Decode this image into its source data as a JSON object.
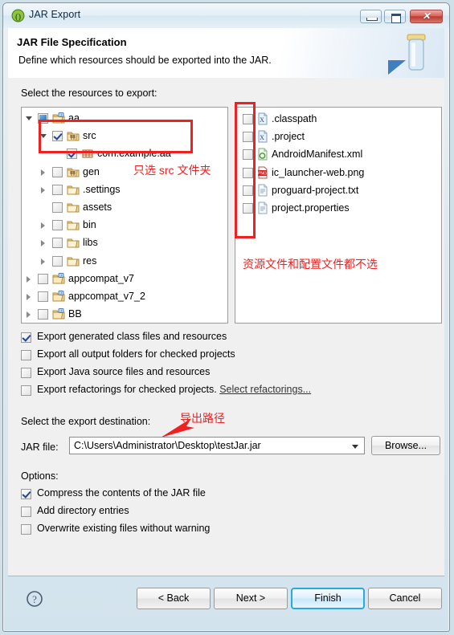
{
  "window": {
    "title": "JAR Export",
    "icon": "jar-export-icon",
    "controls": {
      "minimize": "minimize-icon",
      "maximize": "maximize-icon",
      "close": "✕"
    }
  },
  "header": {
    "title": "JAR File Specification",
    "subtitle": "Define which resources should be exported into the JAR.",
    "graphic": "jar-jar-icon"
  },
  "main": {
    "resources_label": "Select the resources to export:",
    "tree": [
      {
        "label": "aa",
        "indent": 0,
        "arrow": "open",
        "check": "partial",
        "icon": "java-project-icon"
      },
      {
        "label": "src",
        "indent": 1,
        "arrow": "open",
        "check": "checked",
        "icon": "source-folder-icon"
      },
      {
        "label": "com.example.aa",
        "indent": 2,
        "arrow": "none",
        "check": "checked",
        "icon": "package-icon"
      },
      {
        "label": "gen",
        "indent": 1,
        "arrow": "closed",
        "check": "unchecked",
        "icon": "source-folder-icon"
      },
      {
        "label": ".settings",
        "indent": 1,
        "arrow": "closed",
        "check": "unchecked",
        "icon": "folder-icon"
      },
      {
        "label": "assets",
        "indent": 1,
        "arrow": "none",
        "check": "unchecked",
        "icon": "folder-icon"
      },
      {
        "label": "bin",
        "indent": 1,
        "arrow": "closed",
        "check": "unchecked",
        "icon": "folder-icon"
      },
      {
        "label": "libs",
        "indent": 1,
        "arrow": "closed",
        "check": "unchecked",
        "icon": "folder-icon"
      },
      {
        "label": "res",
        "indent": 1,
        "arrow": "closed",
        "check": "unchecked",
        "icon": "folder-icon"
      },
      {
        "label": "appcompat_v7",
        "indent": 0,
        "arrow": "closed",
        "check": "unchecked",
        "icon": "java-project-icon"
      },
      {
        "label": "appcompat_v7_2",
        "indent": 0,
        "arrow": "closed",
        "check": "unchecked",
        "icon": "java-project-icon"
      },
      {
        "label": "BB",
        "indent": 0,
        "arrow": "closed",
        "check": "unchecked",
        "icon": "java-project-icon"
      }
    ],
    "files": [
      {
        "label": ".classpath",
        "check": "unchecked",
        "icon": "xml-file-icon"
      },
      {
        "label": ".project",
        "check": "unchecked",
        "icon": "xml-file-icon"
      },
      {
        "label": "AndroidManifest.xml",
        "check": "unchecked",
        "icon": "android-manifest-icon"
      },
      {
        "label": "ic_launcher-web.png",
        "check": "unchecked",
        "icon": "png-file-icon"
      },
      {
        "label": "proguard-project.txt",
        "check": "unchecked",
        "icon": "text-file-icon"
      },
      {
        "label": "project.properties",
        "check": "unchecked",
        "icon": "text-file-icon"
      }
    ],
    "options": [
      {
        "label": "Export generated class files and resources",
        "check": "checked"
      },
      {
        "label": "Export all output folders for checked projects",
        "check": "unchecked"
      },
      {
        "label": "Export Java source files and resources",
        "check": "unchecked"
      },
      {
        "label": "Export refactorings for checked projects.",
        "check": "unchecked",
        "link": "Select refactorings..."
      }
    ]
  },
  "destination": {
    "label": "Select the export destination:",
    "jarfile_label": "JAR file:",
    "jarfile_value": "C:\\Users\\Administrator\\Desktop\\testJar.jar",
    "browse_label": "Browse..."
  },
  "options_section": {
    "label": "Options:",
    "items": [
      {
        "label": "Compress the contents of the JAR file",
        "check": "checked"
      },
      {
        "label": "Add directory entries",
        "check": "unchecked"
      },
      {
        "label": "Overwrite existing files without warning",
        "check": "unchecked"
      }
    ]
  },
  "footer": {
    "help": "help-icon",
    "back": "< Back",
    "next": "Next >",
    "finish": "Finish",
    "cancel": "Cancel"
  },
  "annotations": {
    "src_note": "只选 src 文件夹",
    "files_note": "资源文件和配置文件都不选",
    "path_note": "导出路径",
    "color": "#f02020"
  }
}
